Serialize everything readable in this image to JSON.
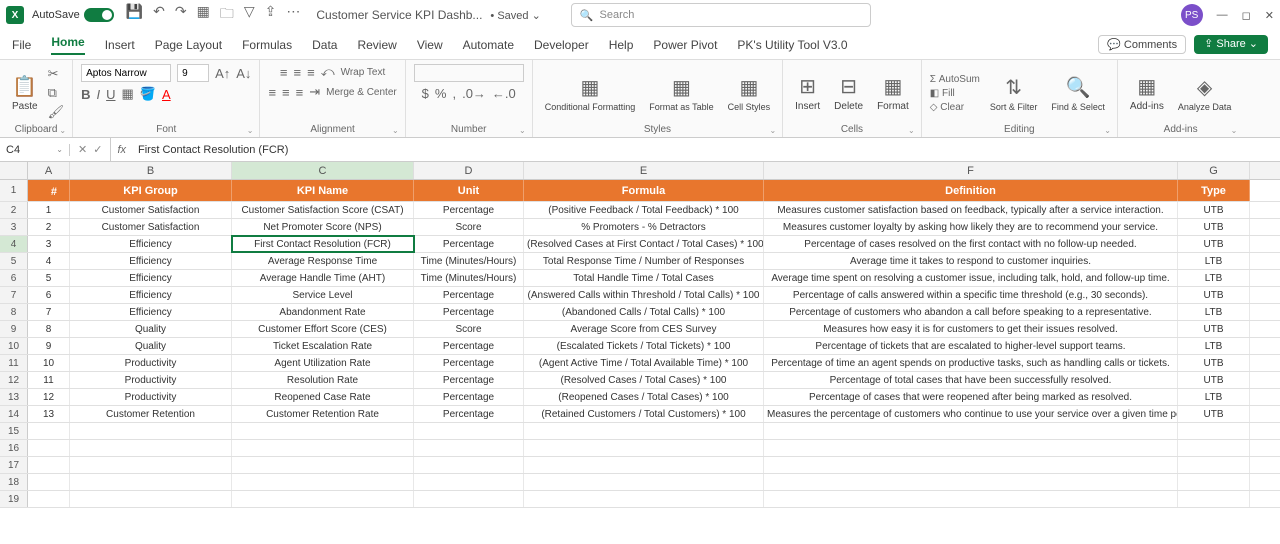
{
  "title_bar": {
    "autosave_label": "AutoSave",
    "autosave_state": "On",
    "doc_title": "Customer Service KPI Dashb...",
    "saved_label": "• Saved ⌄",
    "search_placeholder": "Search",
    "user_initials": "PS"
  },
  "ribbon_tabs": [
    "File",
    "Home",
    "Insert",
    "Page Layout",
    "Formulas",
    "Data",
    "Review",
    "View",
    "Automate",
    "Developer",
    "Help",
    "Power Pivot",
    "PK's Utility Tool V3.0"
  ],
  "active_tab": "Home",
  "ribbon_right": {
    "comments": "Comments",
    "share": "Share"
  },
  "ribbon": {
    "clipboard": {
      "label": "Clipboard",
      "paste": "Paste"
    },
    "font": {
      "label": "Font",
      "name": "Aptos Narrow",
      "size": "9"
    },
    "alignment": {
      "label": "Alignment",
      "wrap": "Wrap Text",
      "merge": "Merge & Center"
    },
    "number": {
      "label": "Number"
    },
    "styles": {
      "label": "Styles",
      "cf": "Conditional Formatting",
      "fat": "Format as Table",
      "cs": "Cell Styles"
    },
    "cells": {
      "label": "Cells",
      "insert": "Insert",
      "delete": "Delete",
      "format": "Format"
    },
    "editing": {
      "label": "Editing",
      "autosum": "AutoSum",
      "fill": "Fill",
      "clear": "Clear",
      "sort": "Sort & Filter",
      "find": "Find & Select"
    },
    "addins": {
      "label": "Add-ins",
      "addins": "Add-ins",
      "analyze": "Analyze Data"
    }
  },
  "name_box": "C4",
  "formula_bar": "First Contact Resolution (FCR)",
  "columns": [
    "A",
    "B",
    "C",
    "D",
    "E",
    "F",
    "G"
  ],
  "active_col": "C",
  "active_row": 4,
  "header_row": [
    "#",
    "KPI Group",
    "KPI Name",
    "Unit",
    "Formula",
    "Definition",
    "Type"
  ],
  "rows": [
    [
      "1",
      "Customer Satisfaction",
      "Customer Satisfaction Score (CSAT)",
      "Percentage",
      "(Positive Feedback / Total Feedback) * 100",
      "Measures customer satisfaction based on feedback, typically after a service interaction.",
      "UTB"
    ],
    [
      "2",
      "Customer Satisfaction",
      "Net Promoter Score (NPS)",
      "Score",
      "% Promoters - % Detractors",
      "Measures customer loyalty by asking how likely they are to recommend your service.",
      "UTB"
    ],
    [
      "3",
      "Efficiency",
      "First Contact Resolution (FCR)",
      "Percentage",
      "(Resolved Cases at First Contact / Total Cases) * 100",
      "Percentage of cases resolved on the first contact with no follow-up needed.",
      "UTB"
    ],
    [
      "4",
      "Efficiency",
      "Average Response Time",
      "Time (Minutes/Hours)",
      "Total Response Time / Number of Responses",
      "Average time it takes to respond to customer inquiries.",
      "LTB"
    ],
    [
      "5",
      "Efficiency",
      "Average Handle Time (AHT)",
      "Time (Minutes/Hours)",
      "Total Handle Time / Total Cases",
      "Average time spent on resolving a customer issue, including talk, hold, and follow-up time.",
      "LTB"
    ],
    [
      "6",
      "Efficiency",
      "Service Level",
      "Percentage",
      "(Answered Calls within Threshold / Total Calls) * 100",
      "Percentage of calls answered within a specific time threshold (e.g., 30 seconds).",
      "UTB"
    ],
    [
      "7",
      "Efficiency",
      "Abandonment Rate",
      "Percentage",
      "(Abandoned Calls / Total Calls) * 100",
      "Percentage of customers who abandon a call before speaking to a representative.",
      "LTB"
    ],
    [
      "8",
      "Quality",
      "Customer Effort Score (CES)",
      "Score",
      "Average Score from CES Survey",
      "Measures how easy it is for customers to get their issues resolved.",
      "UTB"
    ],
    [
      "9",
      "Quality",
      "Ticket Escalation Rate",
      "Percentage",
      "(Escalated Tickets / Total Tickets) * 100",
      "Percentage of tickets that are escalated to higher-level support teams.",
      "LTB"
    ],
    [
      "10",
      "Productivity",
      "Agent Utilization Rate",
      "Percentage",
      "(Agent Active Time / Total Available Time) * 100",
      "Percentage of time an agent spends on productive tasks, such as handling calls or tickets.",
      "UTB"
    ],
    [
      "11",
      "Productivity",
      "Resolution Rate",
      "Percentage",
      "(Resolved Cases / Total Cases) * 100",
      "Percentage of total cases that have been successfully resolved.",
      "UTB"
    ],
    [
      "12",
      "Productivity",
      "Reopened Case Rate",
      "Percentage",
      "(Reopened Cases / Total Cases) * 100",
      "Percentage of cases that were reopened after being marked as resolved.",
      "LTB"
    ],
    [
      "13",
      "Customer Retention",
      "Customer Retention Rate",
      "Percentage",
      "(Retained Customers / Total Customers) * 100",
      "Measures the percentage of customers who continue to use your service over a given time period.",
      "UTB"
    ]
  ],
  "empty_rows": [
    15,
    16,
    17,
    18,
    19
  ]
}
